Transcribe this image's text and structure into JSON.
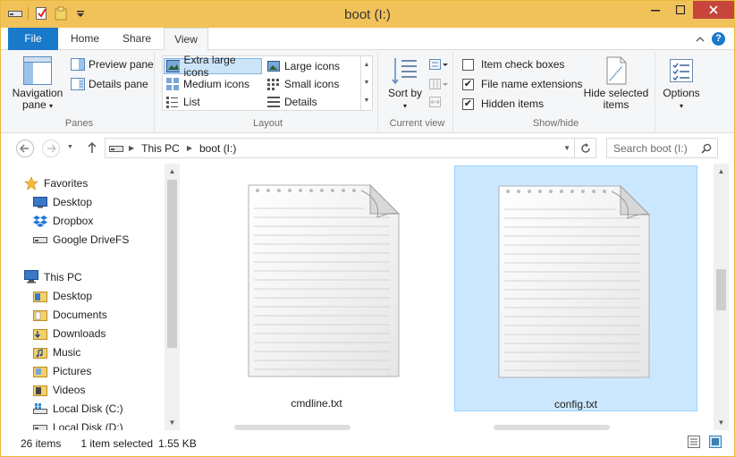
{
  "window": {
    "title": "boot (I:)"
  },
  "quick_access": [
    "drive-icon",
    "properties-icon",
    "new-folder-icon",
    "customize-qat-icon"
  ],
  "tabs": [
    {
      "label": "File"
    },
    {
      "label": "Home"
    },
    {
      "label": "Share"
    },
    {
      "label": "View"
    }
  ],
  "ribbon": {
    "panes": {
      "group_label": "Panes",
      "navigation_pane": "Navigation pane",
      "preview_pane": "Preview pane",
      "details_pane": "Details pane"
    },
    "layout": {
      "group_label": "Layout",
      "options": [
        {
          "label": "Extra large icons",
          "selected": true
        },
        {
          "label": "Large icons",
          "selected": false
        },
        {
          "label": "Medium icons",
          "selected": false
        },
        {
          "label": "Small icons",
          "selected": false
        },
        {
          "label": "List",
          "selected": false
        },
        {
          "label": "Details",
          "selected": false
        }
      ]
    },
    "current_view": {
      "group_label": "Current view",
      "sort_by": "Sort by"
    },
    "show_hide": {
      "group_label": "Show/hide",
      "item_check_boxes": {
        "label": "Item check boxes",
        "checked": false
      },
      "file_name_extensions": {
        "label": "File name extensions",
        "checked": true
      },
      "hidden_items": {
        "label": "Hidden items",
        "checked": true
      },
      "hide_selected_items": "Hide selected items"
    },
    "options": {
      "label": "Options"
    }
  },
  "address": {
    "crumbs": [
      "This PC",
      "boot (I:)"
    ],
    "search_placeholder": "Search boot (I:)"
  },
  "nav": {
    "favorites": {
      "label": "Favorites",
      "items": [
        "Desktop",
        "Dropbox",
        "Google DriveFS"
      ]
    },
    "this_pc": {
      "label": "This PC",
      "items": [
        "Desktop",
        "Documents",
        "Downloads",
        "Music",
        "Pictures",
        "Videos",
        "Local Disk (C:)",
        "Local Disk (D:)"
      ]
    }
  },
  "files": [
    {
      "name": "cmdline.txt",
      "selected": false
    },
    {
      "name": "config.txt",
      "selected": true
    }
  ],
  "status": {
    "item_count": "26 items",
    "selection": "1 item selected",
    "size": "1.55 KB"
  },
  "colors": {
    "titlebar": "#f2c25a",
    "file_tab": "#1979ca",
    "selection": "#cce8ff"
  }
}
